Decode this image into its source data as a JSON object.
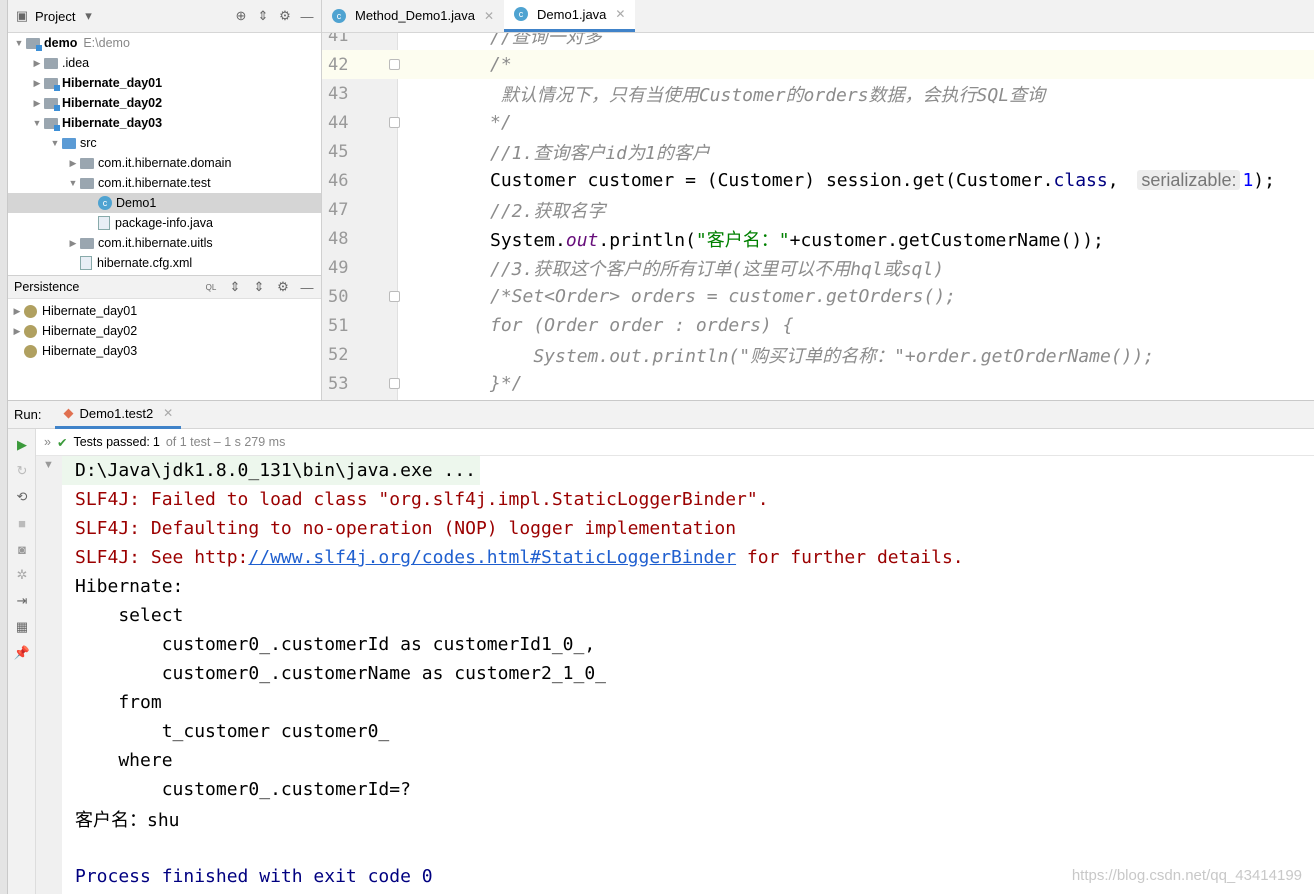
{
  "project_panel": {
    "title": "Project",
    "tree": [
      {
        "label": "demo",
        "extra": "E:\\demo",
        "bold": true,
        "indent": 0,
        "arrow": "▼",
        "icon": "module-folder"
      },
      {
        "label": ".idea",
        "indent": 1,
        "arrow": "▶",
        "icon": "folder"
      },
      {
        "label": "Hibernate_day01",
        "bold": true,
        "indent": 1,
        "arrow": "▶",
        "icon": "module-folder"
      },
      {
        "label": "Hibernate_day02",
        "bold": true,
        "indent": 1,
        "arrow": "▶",
        "icon": "module-folder"
      },
      {
        "label": "Hibernate_day03",
        "bold": true,
        "indent": 1,
        "arrow": "▼",
        "icon": "module-folder"
      },
      {
        "label": "src",
        "indent": 2,
        "arrow": "▼",
        "icon": "source-folder"
      },
      {
        "label": "com.it.hibernate.domain",
        "indent": 3,
        "arrow": "▶",
        "icon": "package"
      },
      {
        "label": "com.it.hibernate.test",
        "indent": 3,
        "arrow": "▼",
        "icon": "package"
      },
      {
        "label": "Demo1",
        "indent": 4,
        "arrow": "",
        "icon": "java-class",
        "selected": true
      },
      {
        "label": "package-info.java",
        "indent": 4,
        "arrow": "",
        "icon": "java-file"
      },
      {
        "label": "com.it.hibernate.uitls",
        "indent": 3,
        "arrow": "▶",
        "icon": "package"
      },
      {
        "label": "hibernate.cfg.xml",
        "indent": 3,
        "arrow": "",
        "icon": "xml-file"
      }
    ]
  },
  "persistence_panel": {
    "title": "Persistence",
    "items": [
      {
        "label": "Hibernate_day01",
        "arrow": "▶"
      },
      {
        "label": "Hibernate_day02",
        "arrow": "▶"
      },
      {
        "label": "Hibernate_day03",
        "arrow": ""
      }
    ]
  },
  "editor_tabs": [
    {
      "label": "Method_Demo1.java",
      "active": false
    },
    {
      "label": "Demo1.java",
      "active": true
    }
  ],
  "code_lines": [
    {
      "n": "41",
      "segs": [
        [
          "comment",
          "//查询一对多"
        ]
      ]
    },
    {
      "n": "42",
      "current": true,
      "fold": true,
      "segs": [
        [
          "comment",
          "/*"
        ]
      ]
    },
    {
      "n": "43",
      "segs": [
        [
          "comment",
          " 默认情况下，只有当使用Customer的orders数据，会执行SQL查询"
        ]
      ]
    },
    {
      "n": "44",
      "fold": true,
      "segs": [
        [
          "comment",
          "*/"
        ]
      ]
    },
    {
      "n": "45",
      "segs": [
        [
          "comment",
          "//1.查询客户id为1的客户"
        ]
      ]
    },
    {
      "n": "46",
      "segs": [
        [
          "",
          "Customer customer = (Customer) session.get(Customer."
        ],
        [
          "kw",
          "class"
        ],
        [
          "",
          ", "
        ],
        [
          "hint",
          "serializable:"
        ],
        [
          "num",
          "1"
        ],
        [
          "",
          ");"
        ]
      ]
    },
    {
      "n": "47",
      "segs": [
        [
          "comment",
          "//2.获取名字"
        ]
      ]
    },
    {
      "n": "48",
      "segs": [
        [
          "",
          "System."
        ],
        [
          "stat",
          "out"
        ],
        [
          "",
          ".println("
        ],
        [
          "str",
          "\"客户名：\""
        ],
        [
          "",
          "+customer.getCustomerName());"
        ]
      ]
    },
    {
      "n": "49",
      "segs": [
        [
          "comment",
          "//3.获取这个客户的所有订单(这里可以不用hql或sql)"
        ]
      ]
    },
    {
      "n": "50",
      "fold": true,
      "segs": [
        [
          "comment",
          "/*Set<Order> orders = customer.getOrders();"
        ]
      ]
    },
    {
      "n": "51",
      "segs": [
        [
          "comment",
          "for (Order order : orders) {"
        ]
      ]
    },
    {
      "n": "52",
      "segs": [
        [
          "comment",
          "    System.out.println(\"购买订单的名称：\"+order.getOrderName());"
        ]
      ]
    },
    {
      "n": "53",
      "fold": true,
      "segs": [
        [
          "comment",
          "}*/"
        ]
      ]
    }
  ],
  "run_panel": {
    "label": "Run:",
    "tab": "Demo1.test2",
    "status": {
      "text": "Tests passed:",
      "passed": "1",
      "rest": "of 1 test – 1 s 279 ms"
    },
    "output": [
      {
        "segs": [
          [
            "",
            "D:\\Java\\jdk1.8.0_131\\bin\\java.exe ..."
          ]
        ],
        "first": true
      },
      {
        "segs": [
          [
            "err",
            "SLF4J: Failed to load class \"org.slf4j.impl.StaticLoggerBinder\"."
          ]
        ]
      },
      {
        "segs": [
          [
            "err",
            "SLF4J: Defaulting to no-operation (NOP) logger implementation"
          ]
        ]
      },
      {
        "segs": [
          [
            "err",
            "SLF4J: See http:"
          ],
          [
            "link",
            "//www.slf4j.org/codes.html#StaticLoggerBinder"
          ],
          [
            "err",
            " for further details."
          ]
        ]
      },
      {
        "segs": [
          [
            "",
            "Hibernate:"
          ]
        ]
      },
      {
        "segs": [
          [
            "",
            "    select"
          ]
        ]
      },
      {
        "segs": [
          [
            "",
            "        customer0_.customerId as customerId1_0_,"
          ]
        ]
      },
      {
        "segs": [
          [
            "",
            "        customer0_.customerName as customer2_1_0_"
          ]
        ]
      },
      {
        "segs": [
          [
            "",
            "    from"
          ]
        ]
      },
      {
        "segs": [
          [
            "",
            "        t_customer customer0_"
          ]
        ]
      },
      {
        "segs": [
          [
            "",
            "    where"
          ]
        ]
      },
      {
        "segs": [
          [
            "",
            "        customer0_.customerId=?"
          ]
        ]
      },
      {
        "segs": [
          [
            "",
            "客户名：shu"
          ]
        ]
      },
      {
        "segs": [
          [
            "",
            ""
          ]
        ]
      },
      {
        "segs": [
          [
            "sys",
            "Process finished with exit code 0"
          ]
        ]
      }
    ]
  },
  "watermark": "https://blog.csdn.net/qq_43414199",
  "colors": {
    "accent": "#4083c9",
    "error": "#9b0000",
    "link": "#1f5fcf",
    "passed": "#3b9a3b"
  }
}
